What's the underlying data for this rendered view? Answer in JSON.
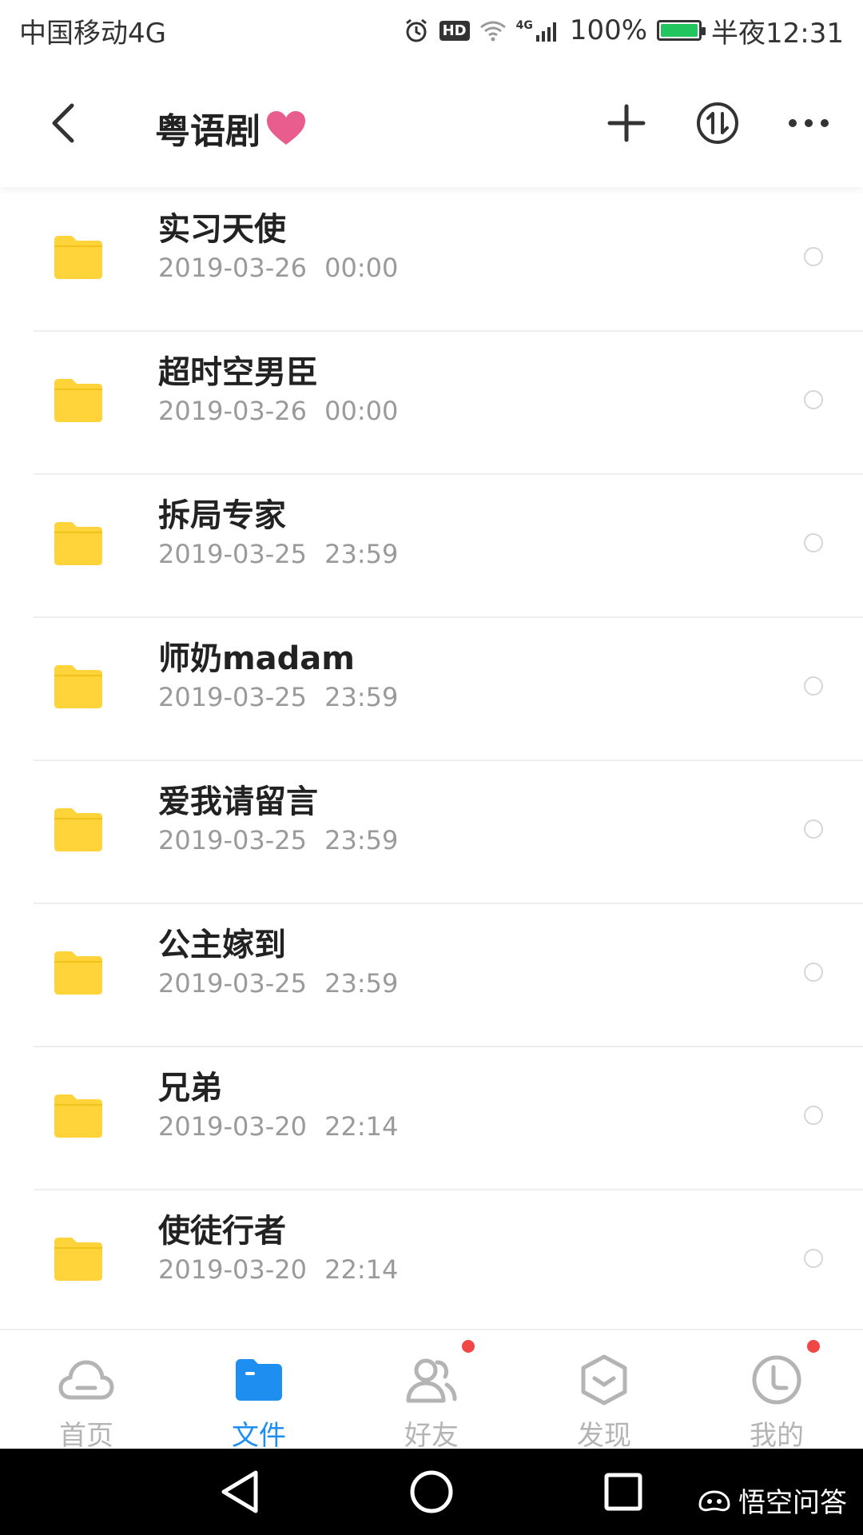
{
  "status_bar": {
    "carrier": "中国移动4G",
    "battery": "100%",
    "battery_level": 1.0,
    "time": "半夜12:31",
    "icons": [
      "alarm-icon",
      "hd-icon",
      "wifi-icon",
      "signal-4g-icon",
      "battery-icon"
    ],
    "hd_label": "HD",
    "net_label": "4G"
  },
  "header": {
    "title": "粤语剧",
    "title_emoji": "heart-icon",
    "heart_color": "#e85d8e",
    "actions": [
      "add-icon",
      "transfer-icon",
      "more-icon"
    ]
  },
  "files": [
    {
      "name": "实习天使",
      "date": "2019-03-26 00:00"
    },
    {
      "name": "超时空男臣",
      "date": "2019-03-26 00:00"
    },
    {
      "name": "拆局专家",
      "date": "2019-03-25 23:59"
    },
    {
      "name": "师奶madam",
      "date": "2019-03-25 23:59"
    },
    {
      "name": "爱我请留言",
      "date": "2019-03-25 23:59"
    },
    {
      "name": "公主嫁到",
      "date": "2019-03-25 23:59"
    },
    {
      "name": "兄弟",
      "date": "2019-03-20 22:14"
    },
    {
      "name": "使徒行者",
      "date": "2019-03-20 22:14"
    }
  ],
  "folder_color": "#ffd43b",
  "tabs": [
    {
      "label": "首页",
      "icon": "cloud-icon",
      "active": false
    },
    {
      "label": "文件",
      "icon": "folder-icon",
      "active": true
    },
    {
      "label": "好友",
      "icon": "friends-icon",
      "active": false,
      "badge": true
    },
    {
      "label": "发现",
      "icon": "discover-icon",
      "active": false
    },
    {
      "label": "我的",
      "icon": "profile-icon",
      "active": false,
      "badge": true
    }
  ],
  "accent_color": "#1e8ff0",
  "nav": {
    "buttons": [
      "back-triangle-icon",
      "home-circle-icon",
      "recents-square-icon"
    ],
    "watermark": "悟空问答"
  }
}
